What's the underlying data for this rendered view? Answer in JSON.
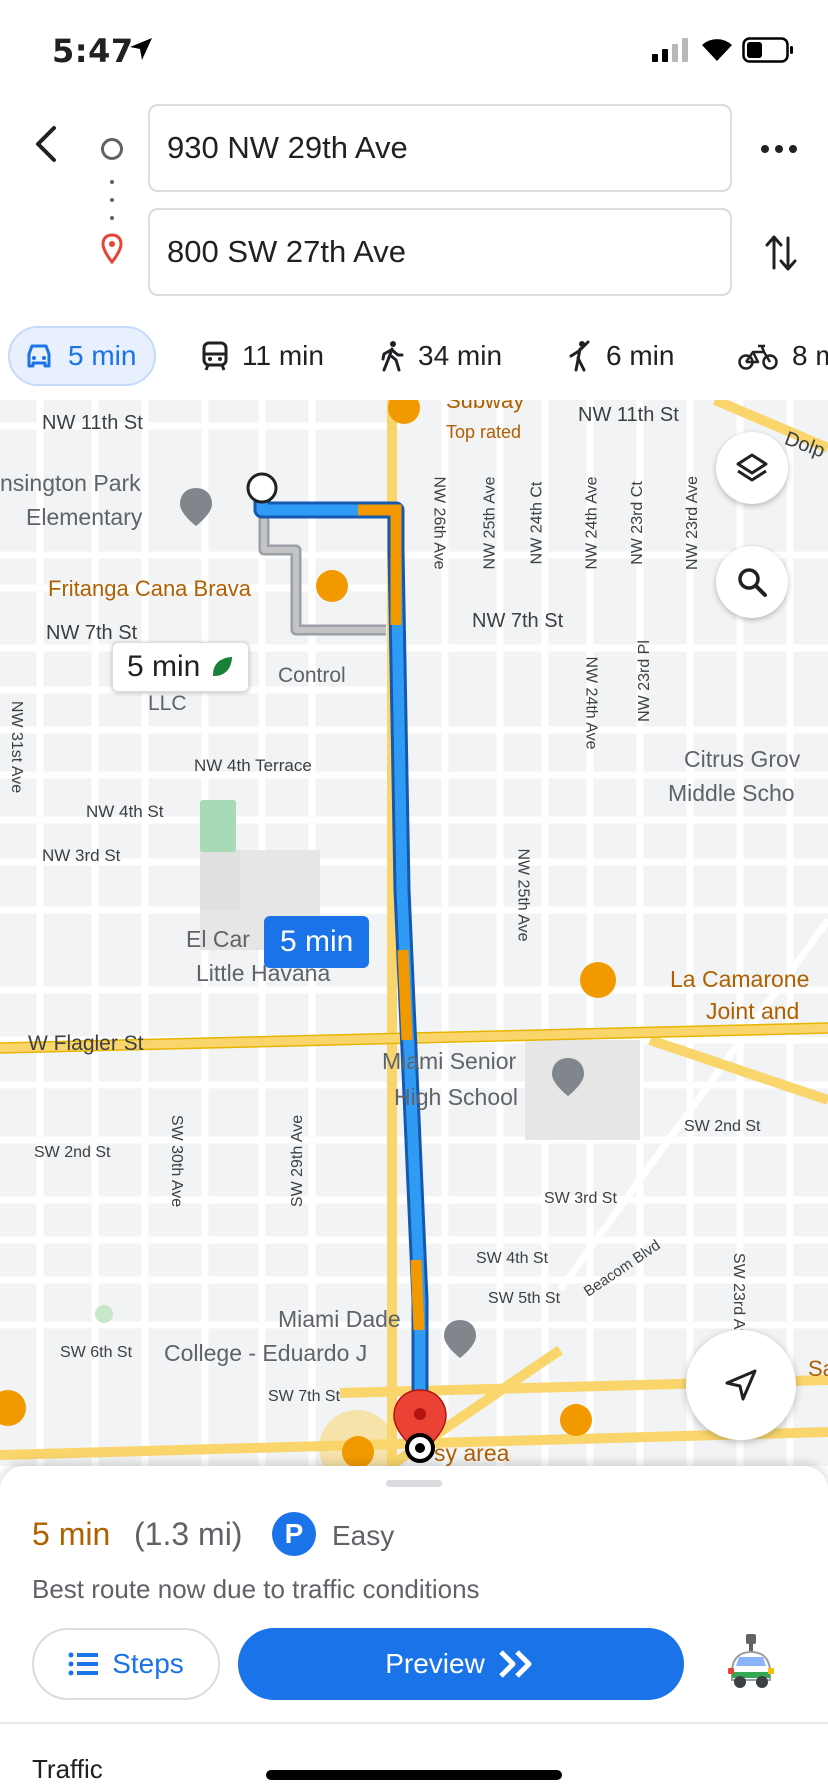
{
  "status_bar": {
    "time": "5:47"
  },
  "directions": {
    "origin": "930 NW 29th Ave",
    "destination": "800 SW 27th Ave"
  },
  "modes": [
    {
      "icon": "car-icon",
      "label": "5 min",
      "selected": true
    },
    {
      "icon": "transit-icon",
      "label": "11 min"
    },
    {
      "icon": "walk-icon",
      "label": "34 min"
    },
    {
      "icon": "rideshare-icon",
      "label": "6 min"
    },
    {
      "icon": "bike-icon",
      "label": "8 m"
    }
  ],
  "map": {
    "streets": {
      "nw11": "NW 11th St",
      "nw11b": "NW 11th St",
      "nw7": "NW 7th St",
      "nw7b": "NW 7th St",
      "nw4t": "NW 4th Terrace",
      "nw4": "NW 4th St",
      "nw3": "NW 3rd St",
      "flagler": "W Flagler St",
      "sw2": "SW 2nd St",
      "sw2b": "SW 2nd St",
      "sw3": "SW 3rd St",
      "sw4": "SW 4th St",
      "sw5": "SW 5th St",
      "sw6": "SW 6th St",
      "sw7": "SW 7th St",
      "beacom": "Beacom Blvd",
      "nw31": "NW 31st Ave",
      "nw26": "NW 26th Ave",
      "nw25": "NW 25th Ave",
      "nw25b": "NW 25th Ave",
      "nw24ct": "NW 24th Ct",
      "nw24": "NW 24th Ave",
      "nw24b": "NW 24th Ave",
      "nw23ct": "NW 23rd Ct",
      "nw23": "NW 23rd Ave",
      "nw23pl": "NW 23rd Pl",
      "sw30": "SW 30th Ave",
      "sw29": "SW 29th Ave",
      "sw23": "SW 23rd Av",
      "dolph": "Dolp",
      "sa": "Sa"
    },
    "places": {
      "subway": "Subway",
      "top_rated": "Top rated",
      "kensington1": "nsington Park",
      "kensington2": "Elementary",
      "fritanga": "Fritanga Cana Brava",
      "control": "Control",
      "llc": "LLC",
      "citrus1": "Citrus Grov",
      "citrus2": "Middle Scho",
      "elcar": "El Car",
      "little_havana": "Little Havana",
      "camarone1": "La Camarone",
      "camarone2": "Joint and",
      "msh1": "Miami Senior",
      "msh2": "High School",
      "mdc1": "Miami Dade",
      "mdc2": "College - Eduardo J",
      "easy_area": "sy area"
    },
    "alt_route_label": "5 min",
    "main_route_label": "5 min"
  },
  "sheet": {
    "eta": "5 min",
    "distance": "(1.3 mi)",
    "parking_badge": "P",
    "parking": "Easy",
    "reason": "Best route now due to traffic conditions",
    "steps_label": "Steps",
    "preview_label": "Preview",
    "traffic_label": "Traffic"
  },
  "colors": {
    "accent": "#1a73e8",
    "route": "#2f9bf5",
    "traffic_slow": "#f29900",
    "eta": "#b06000",
    "destination_pin": "#ea4335"
  }
}
